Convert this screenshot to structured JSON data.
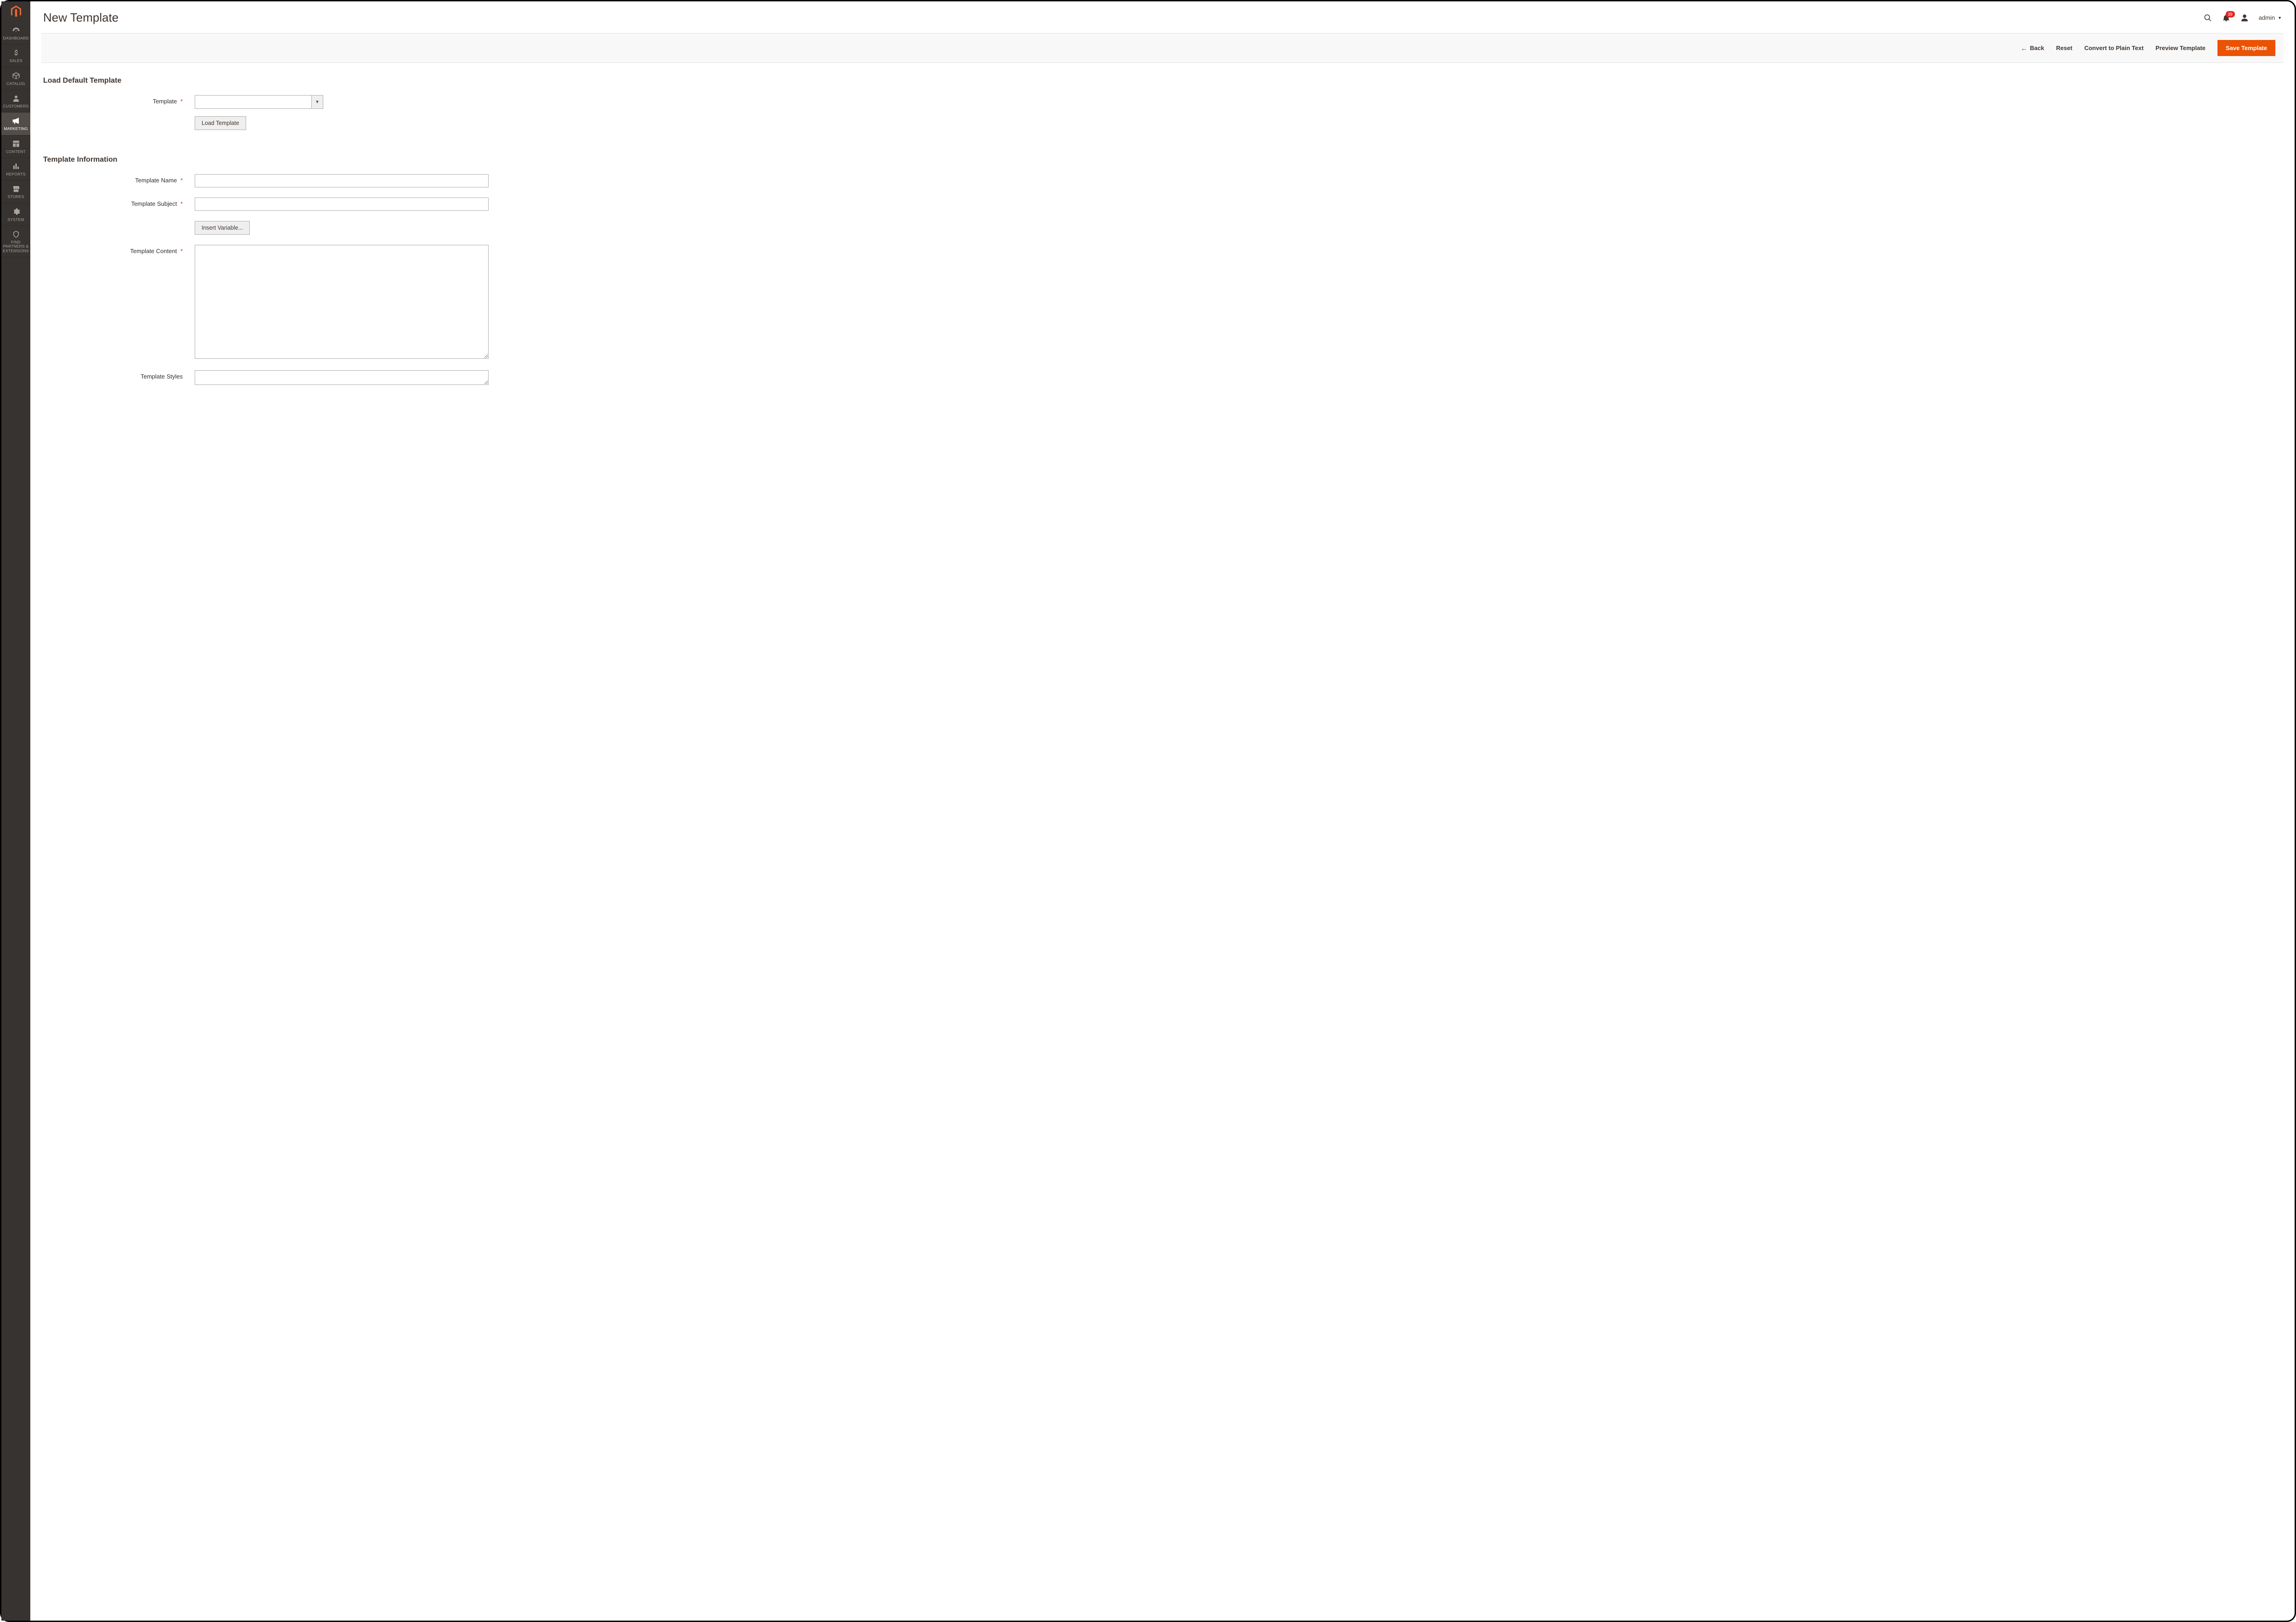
{
  "sidebar": {
    "items": [
      {
        "label": "DASHBOARD"
      },
      {
        "label": "SALES"
      },
      {
        "label": "CATALOG"
      },
      {
        "label": "CUSTOMERS"
      },
      {
        "label": "MARKETING"
      },
      {
        "label": "CONTENT"
      },
      {
        "label": "REPORTS"
      },
      {
        "label": "STORES"
      },
      {
        "label": "SYSTEM"
      },
      {
        "label": "FIND PARTNERS & EXTENSIONS"
      }
    ]
  },
  "header": {
    "title": "New Template",
    "notifications_count": "39",
    "username": "admin"
  },
  "actions": {
    "back": "Back",
    "reset": "Reset",
    "convert": "Convert to Plain Text",
    "preview": "Preview Template",
    "save": "Save Template"
  },
  "sections": {
    "load_default": {
      "title": "Load Default Template",
      "template_label": "Template",
      "template_value": "",
      "load_btn": "Load Template"
    },
    "info": {
      "title": "Template Information",
      "name_label": "Template Name",
      "name_value": "",
      "subject_label": "Template Subject",
      "subject_value": "",
      "insert_var_btn": "Insert Variable...",
      "content_label": "Template Content",
      "content_value": "",
      "styles_label": "Template Styles",
      "styles_value": ""
    }
  },
  "colors": {
    "accent": "#eb5202",
    "sidebar_bg": "#373330",
    "danger": "#e22626"
  }
}
